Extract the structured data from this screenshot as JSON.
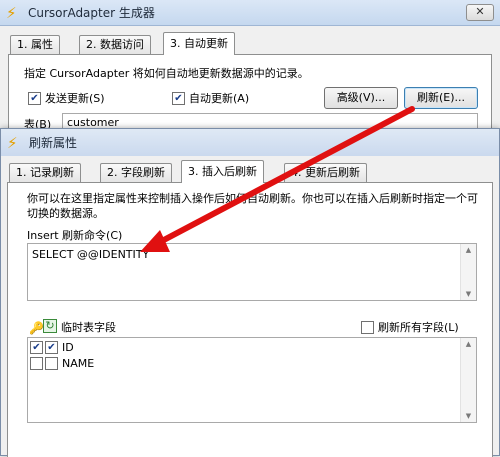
{
  "outer": {
    "title": "CursorAdapter 生成器",
    "tabs": [
      "1. 属性",
      "2. 数据访问",
      "3. 自动更新"
    ],
    "description": "指定 CursorAdapter 将如何自动地更新数据源中的记录。",
    "send_updates_label": "发送更新(S)",
    "auto_update_label": "自动更新(A)",
    "advanced_button": "高级(V)...",
    "refresh_button": "刷新(E)...",
    "table_label": "表(B)",
    "table_value": "customer"
  },
  "inner": {
    "title": "刷新属性",
    "tabs": [
      "1. 记录刷新",
      "2. 字段刷新",
      "3. 插入后刷新",
      "4. 更新后刷新"
    ],
    "description": "你可以在这里指定属性来控制插入操作后如何自动刷新。你也可以在插入后刷新时指定一个可切换的数据源。",
    "insert_cmd_label": "Insert 刷新命令(C)",
    "insert_cmd_value": "SELECT @@IDENTITY",
    "temp_fields_label": "临时表字段",
    "refresh_all_label": "刷新所有字段(L)",
    "fields": [
      {
        "name": "ID",
        "key": true,
        "selected": true
      },
      {
        "name": "NAME",
        "key": false,
        "selected": false
      }
    ]
  },
  "colors": {
    "arrow": "#e01010",
    "check": "#1a3d8a"
  }
}
